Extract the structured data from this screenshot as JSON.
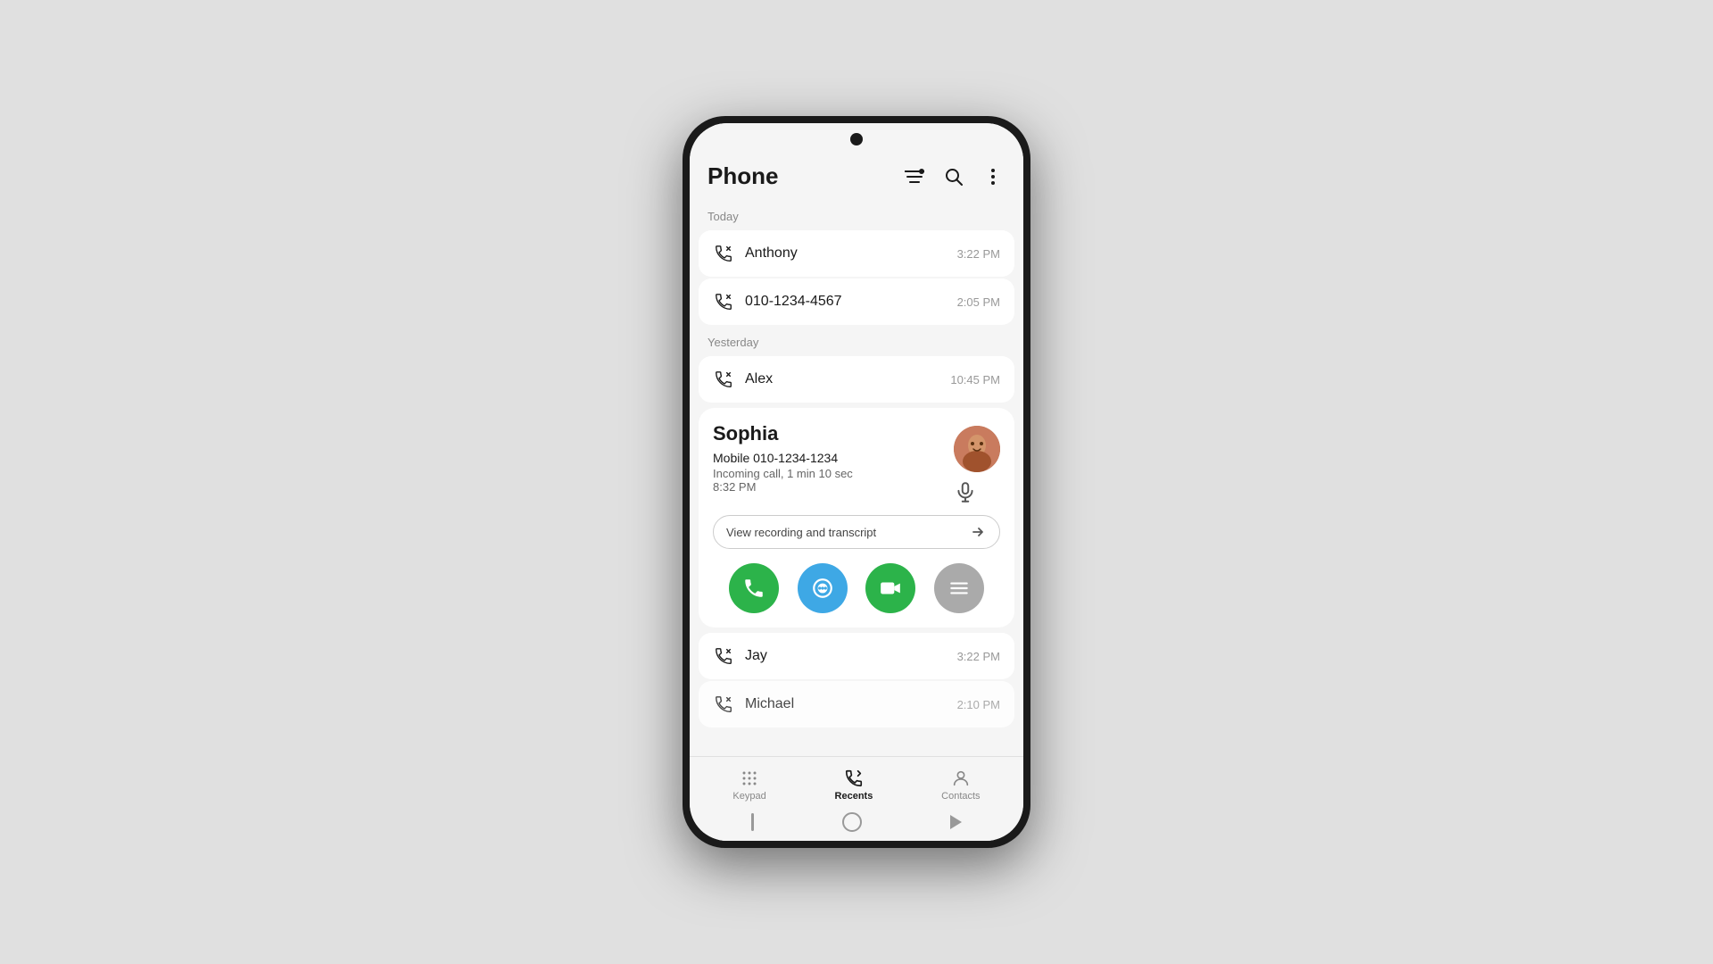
{
  "app": {
    "title": "Phone",
    "header_icons": {
      "filter": "filter-icon",
      "search": "search-icon",
      "more": "more-icon"
    }
  },
  "sections": {
    "today_label": "Today",
    "yesterday_label": "Yesterday"
  },
  "calls": {
    "today": [
      {
        "name": "Anthony",
        "time": "3:22 PM",
        "type": "outgoing"
      },
      {
        "name": "010-1234-4567",
        "time": "2:05 PM",
        "type": "outgoing"
      }
    ],
    "yesterday": [
      {
        "name": "Alex",
        "time": "10:45 PM",
        "type": "missed"
      }
    ],
    "expanded": {
      "name": "Sophia",
      "detail_main": "Mobile 010-1234-1234",
      "detail_sub": "Incoming call, 1 min 10 sec",
      "time": "8:32 PM",
      "recording_btn": "View recording and transcript"
    },
    "more": [
      {
        "name": "Jay",
        "time": "3:22 PM",
        "type": "outgoing"
      },
      {
        "name": "Michael",
        "time": "2:10 PM",
        "type": "outgoing"
      }
    ]
  },
  "action_buttons": {
    "phone": "phone-action",
    "message": "message-action",
    "video": "video-action",
    "more": "more-action"
  },
  "nav": {
    "keypad_label": "Keypad",
    "recents_label": "Recents",
    "contacts_label": "Contacts"
  }
}
